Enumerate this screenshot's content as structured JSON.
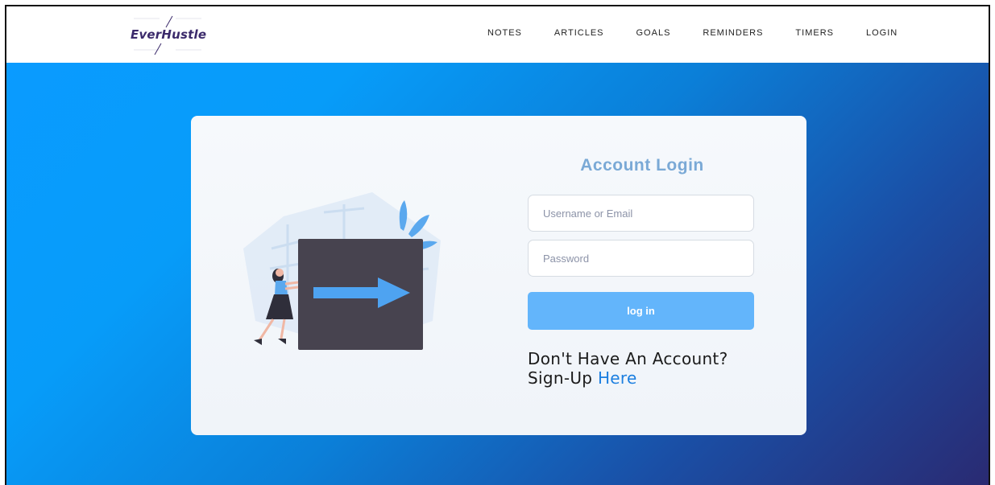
{
  "brand": {
    "name": "EverHustle"
  },
  "nav": {
    "items": [
      {
        "label": "NOTES"
      },
      {
        "label": "ARTICLES"
      },
      {
        "label": "GOALS"
      },
      {
        "label": "REMINDERS"
      },
      {
        "label": "TIMERS"
      },
      {
        "label": "LOGIN"
      }
    ]
  },
  "login": {
    "title": "Account Login",
    "username_placeholder": "Username or Email",
    "password_placeholder": "Password",
    "button_label": "log in",
    "signup_prompt_line1": "Don't Have An Account?",
    "signup_prompt_line2": "Sign-Up",
    "signup_link": "Here"
  },
  "icons": {
    "illustration": "person-pushing-arrow-box-illustration"
  },
  "colors": {
    "brand_text": "#3b2a6b",
    "gradient_start": "#0a9bff",
    "gradient_end": "#2a2a72",
    "title": "#7aa9d6",
    "button": "#63b5fb",
    "link": "#1c7fe0",
    "box": "#47434f",
    "arrow": "#4ea3f1"
  }
}
